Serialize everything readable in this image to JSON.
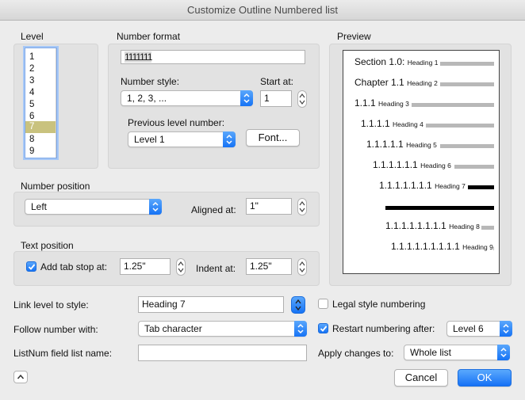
{
  "window": {
    "title": "Customize Outline Numbered list"
  },
  "level": {
    "label": "Level",
    "items": [
      "1",
      "2",
      "3",
      "4",
      "5",
      "6",
      "7",
      "8",
      "9"
    ],
    "selected_index": 6
  },
  "number_format": {
    "label": "Number format",
    "format_value": "1111111",
    "number_style_label": "Number style:",
    "number_style_value": "1, 2, 3, ...",
    "start_at_label": "Start at:",
    "start_at_value": "1",
    "previous_level_label": "Previous level number:",
    "previous_level_value": "Level 1",
    "font_button": "Font..."
  },
  "preview": {
    "label": "Preview",
    "lines": [
      {
        "number": "Section 1.0:",
        "heading": "Heading 1"
      },
      {
        "number": "Chapter 1.1",
        "heading": "Heading 2"
      },
      {
        "number": "1.1.1",
        "heading": "Heading 3"
      },
      {
        "number": "1.1.1.1",
        "heading": "Heading 4"
      },
      {
        "number": "1.1.1.1.1",
        "heading": "Heading 5"
      },
      {
        "number": "1.1.1.1.1.1",
        "heading": "Heading 6"
      },
      {
        "number": "1.1.1.1.1.1.1",
        "heading": "Heading 7"
      },
      {
        "number": "1.1.1.1.1.1.1.1",
        "heading": "Heading 8"
      },
      {
        "number": "1.1.1.1.1.1.1.1.1",
        "heading": "Heading 9"
      }
    ]
  },
  "number_position": {
    "label": "Number position",
    "alignment_value": "Left",
    "aligned_at_label": "Aligned at:",
    "aligned_at_value": "1\""
  },
  "text_position": {
    "label": "Text position",
    "add_tab_stop_label": "Add tab stop at:",
    "add_tab_stop_checked": true,
    "tab_stop_value": "1.25\"",
    "indent_at_label": "Indent at:",
    "indent_at_value": "1.25\""
  },
  "bottom": {
    "link_level_label": "Link level to style:",
    "link_level_value": "Heading 7",
    "legal_style_label": "Legal style numbering",
    "legal_style_checked": false,
    "follow_number_label": "Follow number with:",
    "follow_number_value": "Tab character",
    "restart_label": "Restart numbering after:",
    "restart_checked": true,
    "restart_value": "Level 6",
    "listnum_label": "ListNum field list name:",
    "listnum_value": "",
    "apply_changes_label": "Apply changes to:",
    "apply_changes_value": "Whole list",
    "cancel_button": "Cancel",
    "ok_button": "OK"
  },
  "colors": {
    "accent": "#1673f5",
    "selection": "#c9c27e"
  }
}
